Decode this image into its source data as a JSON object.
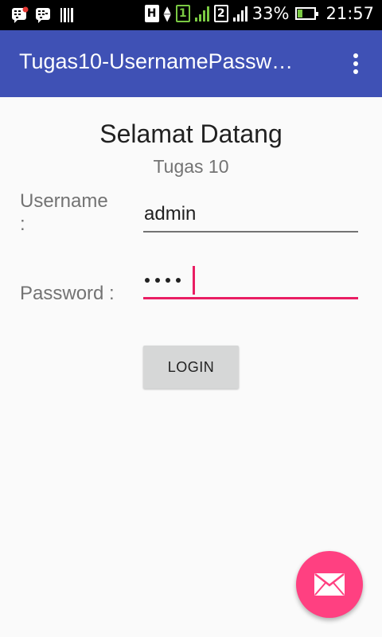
{
  "status_bar": {
    "network_type": "H",
    "sim1": "1",
    "sim2": "2",
    "battery": "33%",
    "time": "21:57",
    "icons": [
      "bbm-notification-icon",
      "bbm-icon",
      "barcode-icon",
      "signal-icon",
      "battery-charging-icon"
    ]
  },
  "app_bar": {
    "title": "Tugas10-UsernamePassw…",
    "overflow_icon": "more-vert-icon"
  },
  "header": {
    "title": "Selamat Datang",
    "subtitle": "Tugas 10"
  },
  "form": {
    "username_label": "Username :",
    "username_value": "admin",
    "password_label": "Password :",
    "password_masked_length": 4
  },
  "login_button": {
    "label": "LOGIN"
  },
  "fab": {
    "icon": "email-icon"
  },
  "colors": {
    "primary": "#3f51b5",
    "accent": "#ff4081",
    "focus_underline": "#e91e63"
  }
}
